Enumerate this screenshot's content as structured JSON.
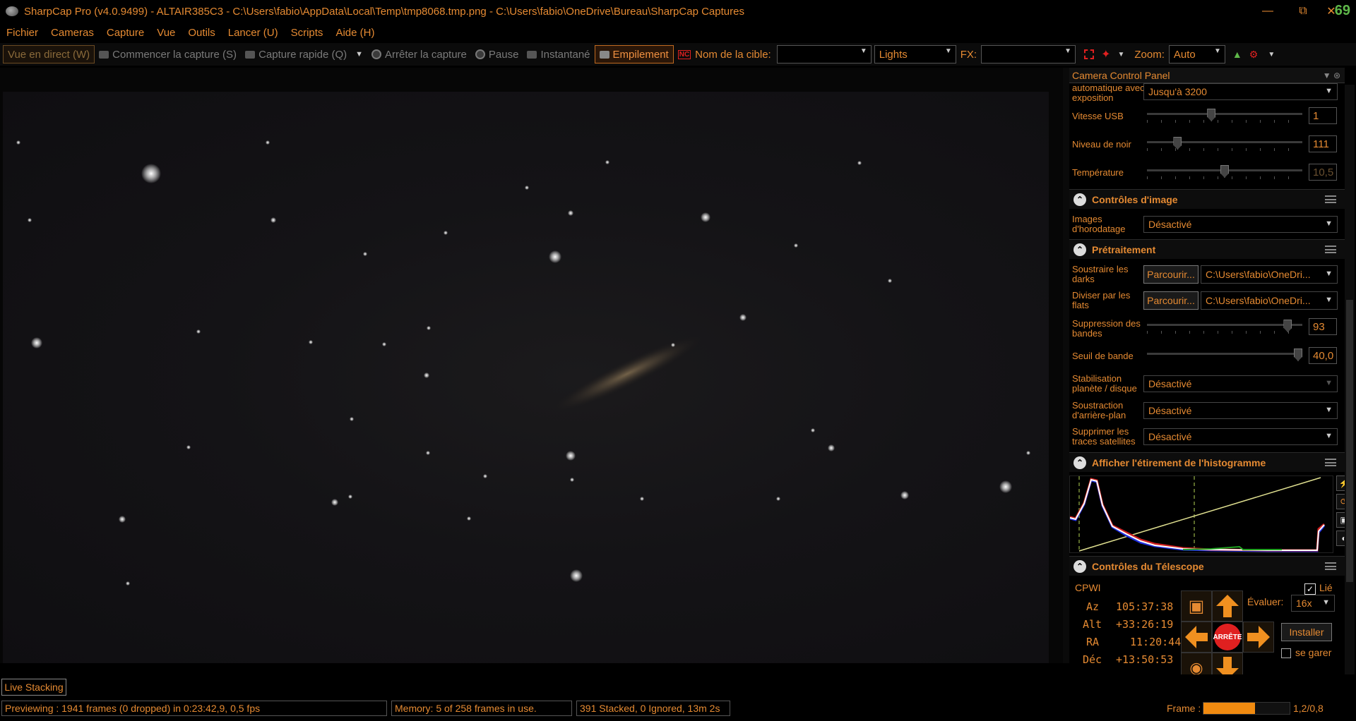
{
  "window": {
    "title": "SharpCap Pro (v4.0.9499) - ALTAIR385C3 - C:\\Users\\fabio\\AppData\\Local\\Temp\\tmp8068.tmp.png - C:\\Users\\fabio\\OneDrive\\Bureau\\SharpCap Captures",
    "badge": "69"
  },
  "menu": [
    "Fichier",
    "Cameras",
    "Capture",
    "Vue",
    "Outils",
    "Lancer (U)",
    "Scripts",
    "Aide (H)"
  ],
  "toolbar": {
    "live_view": "Vue en direct (W)",
    "start_capture": "Commencer la capture (S)",
    "quick_capture": "Capture rapide (Q)",
    "stop_capture": "Arrêter la capture",
    "pause": "Pause",
    "snapshot": "Instantané",
    "stacking": "Empilement",
    "target_label": "Nom de la cible:",
    "target_value": "",
    "frame_type": "Lights",
    "fx_label": "FX:",
    "fx_value": "",
    "zoom_label": "Zoom:",
    "zoom_value": "Auto"
  },
  "panel": {
    "title": "Camera Control Panel",
    "auto_exposure_label": "automatique avec exposition",
    "auto_exposure_value": "Jusqu'à 3200",
    "usb_label": "Vitesse USB",
    "usb_value": "1",
    "usb_level": 0.41,
    "black_label": "Niveau de noir",
    "black_value": "111",
    "black_level": 0.18,
    "temp_label": "Température",
    "temp_value": "10,5",
    "temp_level": 0.5,
    "image_controls_title": "Contrôles d'image",
    "timestamp_label": "Images d'horodatage",
    "timestamp_value": "Désactivé",
    "preprocessing_title": "Prétraitement",
    "darks_label": "Soustraire les darks",
    "darks_button": "Parcourir...",
    "darks_path": "C:\\Users\\fabio\\OneDri...",
    "flats_label": "Diviser par les flats",
    "flats_button": "Parcourir...",
    "flats_path": "C:\\Users\\fabio\\OneDri...",
    "banding_label": "Suppression des bandes",
    "banding_value": "93",
    "banding_level": 0.93,
    "band_threshold_label": "Seuil de bande",
    "band_threshold_value": "40,0",
    "band_threshold_level": 1.0,
    "stabilization_label": "Stabilisation planète / disque",
    "stabilization_value": "Désactivé",
    "background_label": "Soustraction d'arrière-plan",
    "background_value": "Désactivé",
    "satellite_label": "Supprimer les traces satellites",
    "satellite_value": "Désactivé",
    "histogram_title": "Afficher l'étirement de l'histogramme",
    "telescope_title": "Contrôles du Télescope",
    "mount": "CPWI",
    "linked_label": "Lié",
    "az_label": "Az",
    "az_value": "105:37:38",
    "alt_label": "Alt",
    "alt_value": "+33:26:19",
    "ra_label": "RA",
    "ra_value": "11:20:44",
    "dec_label": "Déc",
    "dec_value": "+13:50:53",
    "rate_label": "Évaluer:",
    "rate_value": "16x",
    "install_button": "Installer",
    "park_label": "se garer",
    "stop_label": "ARRÊTE"
  },
  "tabs": {
    "live_stacking": "Live Stacking"
  },
  "status": {
    "preview": "Previewing : 1941 frames (0 dropped) in 0:23:42,9, 0,5 fps",
    "memory": "Memory: 5 of 258 frames in use.",
    "stacked": "391 Stacked, 0 Ignored, 13m 2s",
    "frame_label": "Frame :",
    "frame_value": "1,2/0,8",
    "frame_progress": 0.6
  },
  "colors": {
    "accent": "#e58a32",
    "background": "#000000",
    "stop": "#e02020",
    "linked_check": "#ffffff"
  }
}
